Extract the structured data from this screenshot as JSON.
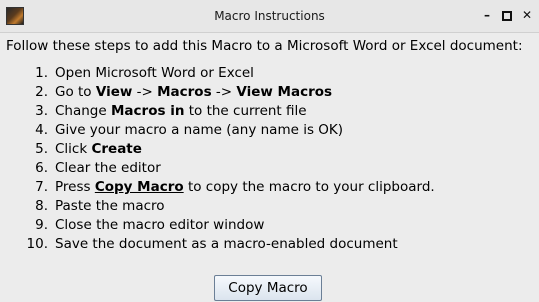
{
  "window": {
    "title": "Macro Instructions",
    "controls": {
      "minimize": "–",
      "close": "✕"
    }
  },
  "intro": "Follow these steps to add this Macro to a Microsoft Word or Excel document:",
  "steps": [
    {
      "num": "1.",
      "parts": [
        {
          "text": "Open Microsoft Word or Excel",
          "style": "normal"
        }
      ]
    },
    {
      "num": "2.",
      "parts": [
        {
          "text": "Go to ",
          "style": "normal"
        },
        {
          "text": "View",
          "style": "bold"
        },
        {
          "text": " -> ",
          "style": "normal"
        },
        {
          "text": "Macros",
          "style": "bold"
        },
        {
          "text": " -> ",
          "style": "normal"
        },
        {
          "text": "View Macros",
          "style": "bold"
        }
      ]
    },
    {
      "num": "3.",
      "parts": [
        {
          "text": "Change ",
          "style": "normal"
        },
        {
          "text": "Macros in",
          "style": "bold"
        },
        {
          "text": " to the current file",
          "style": "normal"
        }
      ]
    },
    {
      "num": "4.",
      "parts": [
        {
          "text": "Give your macro a name (any name is OK)",
          "style": "normal"
        }
      ]
    },
    {
      "num": "5.",
      "parts": [
        {
          "text": "Click ",
          "style": "normal"
        },
        {
          "text": "Create",
          "style": "bold"
        }
      ]
    },
    {
      "num": "6.",
      "parts": [
        {
          "text": "Clear the editor",
          "style": "normal"
        }
      ]
    },
    {
      "num": "7.",
      "parts": [
        {
          "text": "Press ",
          "style": "normal"
        },
        {
          "text": "Copy Macro",
          "style": "underline"
        },
        {
          "text": " to copy the macro to your clipboard.",
          "style": "normal"
        }
      ]
    },
    {
      "num": "8.",
      "parts": [
        {
          "text": "Paste the macro",
          "style": "normal"
        }
      ]
    },
    {
      "num": "9.",
      "parts": [
        {
          "text": "Close the macro editor window",
          "style": "normal"
        }
      ]
    },
    {
      "num": "10.",
      "parts": [
        {
          "text": "Save the document as a macro-enabled document",
          "style": "normal"
        }
      ]
    }
  ],
  "button": {
    "label": "Copy Macro"
  }
}
